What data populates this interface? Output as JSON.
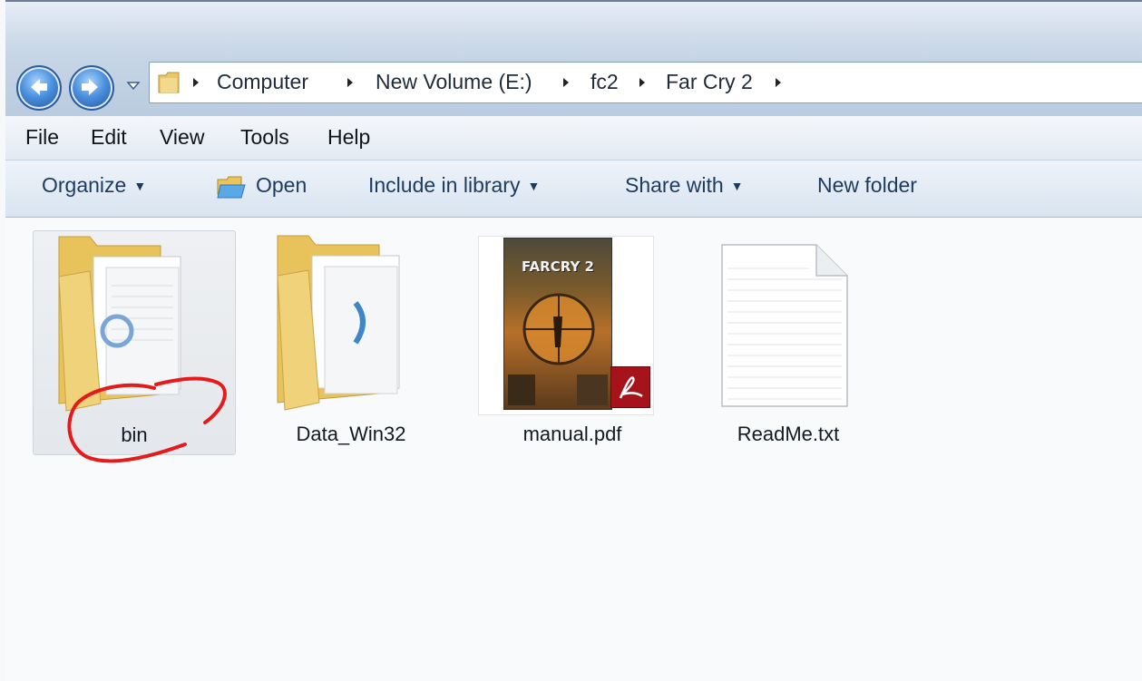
{
  "address": {
    "breadcrumbs": [
      "Computer",
      "New Volume (E:)",
      "fc2",
      "Far Cry 2"
    ]
  },
  "menu": {
    "items": [
      "File",
      "Edit",
      "View",
      "Tools",
      "Help"
    ]
  },
  "toolbar": {
    "organize": "Organize",
    "open": "Open",
    "include": "Include in library",
    "share": "Share with",
    "new_folder": "New folder"
  },
  "files": [
    {
      "name": "bin",
      "type": "folder",
      "selected": true,
      "annotated": true
    },
    {
      "name": "Data_Win32",
      "type": "folder"
    },
    {
      "name": "manual.pdf",
      "type": "pdf",
      "cover_text": "FARCRY 2"
    },
    {
      "name": "ReadMe.txt",
      "type": "text"
    }
  ],
  "colors": {
    "accent": "#3b7bd0",
    "annotation": "#e41b1b",
    "pdf_badge": "#a7131a"
  },
  "icons": {
    "back": "back-arrow-icon",
    "forward": "forward-arrow-icon",
    "folder": "folder-icon",
    "pdf": "pdf-icon",
    "text": "text-file-icon"
  }
}
